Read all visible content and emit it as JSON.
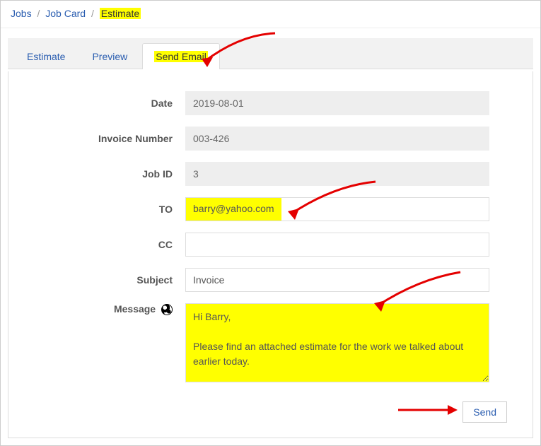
{
  "breadcrumb": {
    "level1": "Jobs",
    "level2": "Job Card",
    "current": "Estimate"
  },
  "tabs": {
    "estimate": "Estimate",
    "preview": "Preview",
    "send_email": "Send Email"
  },
  "labels": {
    "date": "Date",
    "invoice_number": "Invoice Number",
    "job_id": "Job ID",
    "to": "TO",
    "cc": "CC",
    "subject": "Subject",
    "message": "Message"
  },
  "form": {
    "date": "2019-08-01",
    "invoice_number": "003-426",
    "job_id": "3",
    "to": "barry@yahoo.com",
    "cc": "",
    "subject": "Invoice",
    "message": "Hi Barry,\n\nPlease find an attached estimate for the work we talked about earlier today.\n\n"
  },
  "buttons": {
    "send": "Send"
  }
}
